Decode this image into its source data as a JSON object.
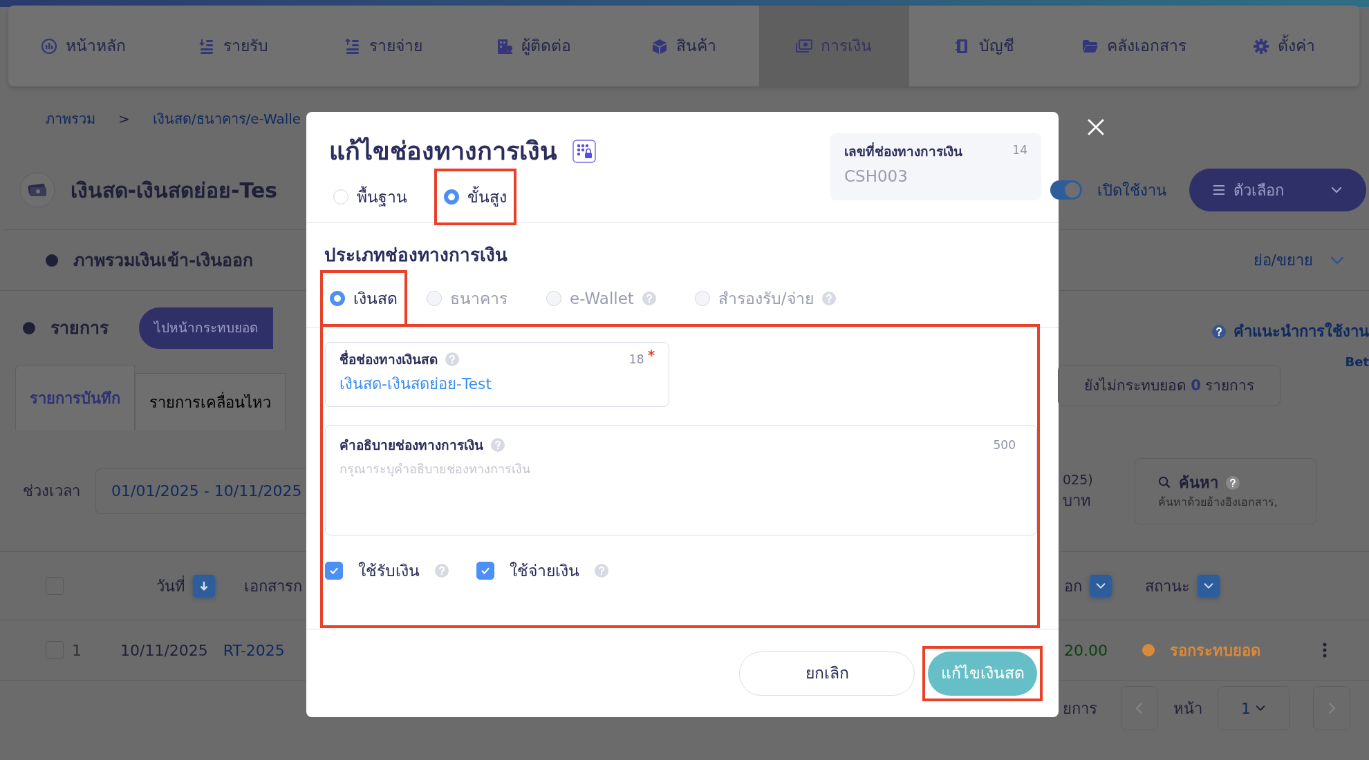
{
  "nav": {
    "items": [
      {
        "label": "หน้าหลัก",
        "selected": false
      },
      {
        "label": "รายรับ",
        "selected": false
      },
      {
        "label": "รายจ่าย",
        "selected": false
      },
      {
        "label": "ผู้ติดต่อ",
        "selected": false
      },
      {
        "label": "สินค้า",
        "selected": false
      },
      {
        "label": "การเงิน",
        "selected": true
      },
      {
        "label": "บัญชี",
        "selected": false
      },
      {
        "label": "คลังเอกสาร",
        "selected": false
      },
      {
        "label": "ตั้งค่า",
        "selected": false
      }
    ]
  },
  "page": {
    "breadcrumb": [
      "ภาพรวม",
      ">",
      "เงินสด/ธนาคาร/e-Walle"
    ],
    "title": "เงินสด-เงินสดย่อย-Tes",
    "status_toggle": {
      "on": true,
      "label": "เปิดใช้งาน"
    },
    "options_button": "ตัวเลือก",
    "overview": {
      "title": "ภาพรวมเงินเข้า-เงินออก",
      "toggle": "ย่อ/ขยาย"
    },
    "entries": {
      "title": "รายการ",
      "button": "ไปหน้ากระทบยอด",
      "help": "คำแนะนำการใช้งาน",
      "beta": "Bet"
    },
    "tabs": [
      {
        "label": "รายการบันทึก",
        "selected": true
      },
      {
        "label": "รายการเคลื่อนไหว",
        "selected": false
      }
    ],
    "unreconciled": "ยังไม่กระทบยอด **0** รายการ",
    "period": {
      "label": "ช่วงเวลา",
      "value": "01/01/2025 - 10/11/2025"
    },
    "summary": [
      "025)",
      "บาท"
    ],
    "search": {
      "label": "ค้นหา",
      "placeholder": "ค้นหาด้วยอ้างอิงเอกสาร,"
    },
    "table": {
      "select_all": {
        "checked": false
      },
      "columns_left": [
        {
          "label": "วันที่",
          "kind": "sort"
        },
        {
          "label": "เอกสารก",
          "kind": "plain"
        }
      ],
      "columns_right": [
        {
          "label": "อก",
          "kind": "filter"
        },
        {
          "label": "สถานะ",
          "kind": "filter"
        }
      ],
      "rows": [
        {
          "checked": false,
          "number": "1",
          "date": "10/11/2025",
          "document": "RT-2025",
          "amount": "20.00",
          "status": "รอกระทบยอด",
          "color": "#d98a3a"
        }
      ]
    },
    "pagination": {
      "tail": "ยการ",
      "page_label": "หน้า",
      "page": "1"
    }
  },
  "modal": {
    "title": "แก้ไขช่องทางการเงิน",
    "modes": [
      {
        "label": "พื้นฐาน",
        "selected": false,
        "highlighted": false
      },
      {
        "label": "ขั้นสูง",
        "selected": true,
        "highlighted": true
      }
    ],
    "code_box": {
      "label": "เลขที่ช่องทางการเงิน",
      "counter": "14",
      "value": "CSH003"
    },
    "type_heading": "ประเภทช่องทางการเงิน",
    "types": [
      {
        "label": "เงินสด",
        "selected": true,
        "disabled": false,
        "help": false,
        "highlighted": true
      },
      {
        "label": "ธนาคาร",
        "selected": false,
        "disabled": true,
        "help": false,
        "highlighted": false
      },
      {
        "label": "e-Wallet",
        "selected": false,
        "disabled": true,
        "help": true,
        "highlighted": false
      },
      {
        "label": "สำรองรับ/จ่าย",
        "selected": false,
        "disabled": true,
        "help": true,
        "highlighted": false
      }
    ],
    "fields_highlighted": true,
    "name_field": {
      "label": "ชื่อช่องทางเงินสด",
      "counter": "18",
      "required": true,
      "value": "เงินสด-เงินสดย่อย-Test"
    },
    "description_field": {
      "label": "คำอธิบายช่องทางการเงิน",
      "counter": "500",
      "placeholder": "กรุณาระบุคำอธิบายช่องทางการเงิน"
    },
    "usage": [
      {
        "label": "ใช้รับเงิน",
        "checked": true
      },
      {
        "label": "ใช้จ่ายเงิน",
        "checked": true
      }
    ],
    "cancel_button": "ยกเลิก",
    "submit_button": {
      "label": "แก้ไขเงินสด",
      "highlighted": true
    }
  }
}
